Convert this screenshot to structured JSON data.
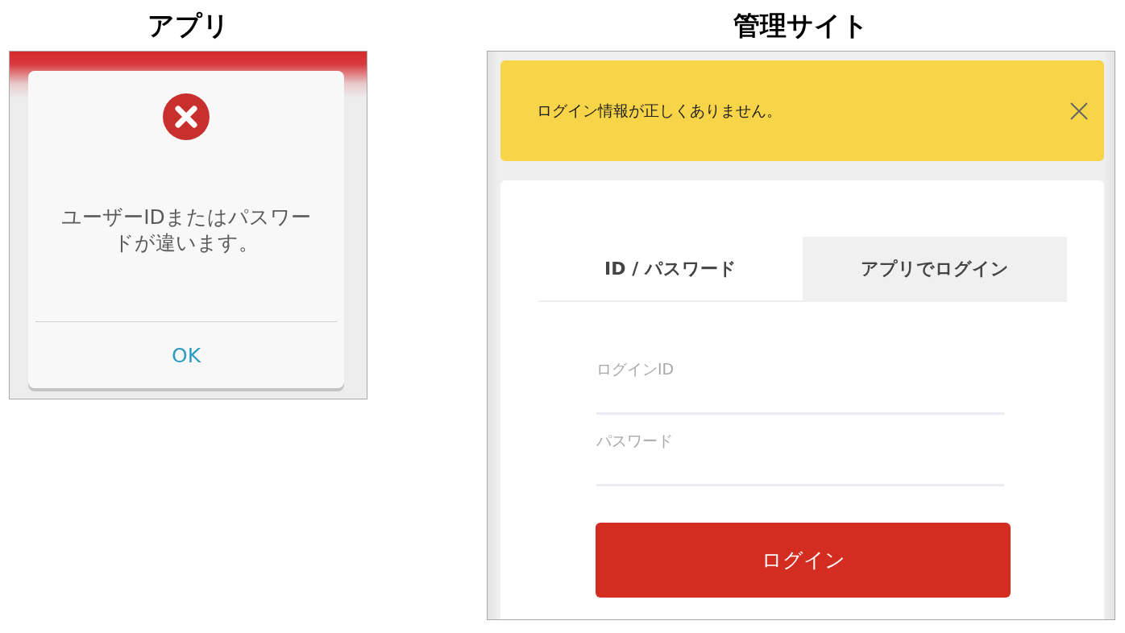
{
  "app": {
    "title": "アプリ",
    "dialog": {
      "message": "ユーザーIDまたはパスワードが違います。",
      "button": "OK"
    }
  },
  "admin_site": {
    "title": "管理サイト",
    "alert": {
      "message": "ログイン情報が正しくありません。"
    },
    "tabs": [
      {
        "label": "ID / パスワード",
        "selected": true
      },
      {
        "label": "アプリでログイン",
        "selected": false
      }
    ],
    "fields": [
      {
        "placeholder": "ログインID"
      },
      {
        "placeholder": "パスワード"
      }
    ],
    "submit_button": "ログイン"
  }
}
